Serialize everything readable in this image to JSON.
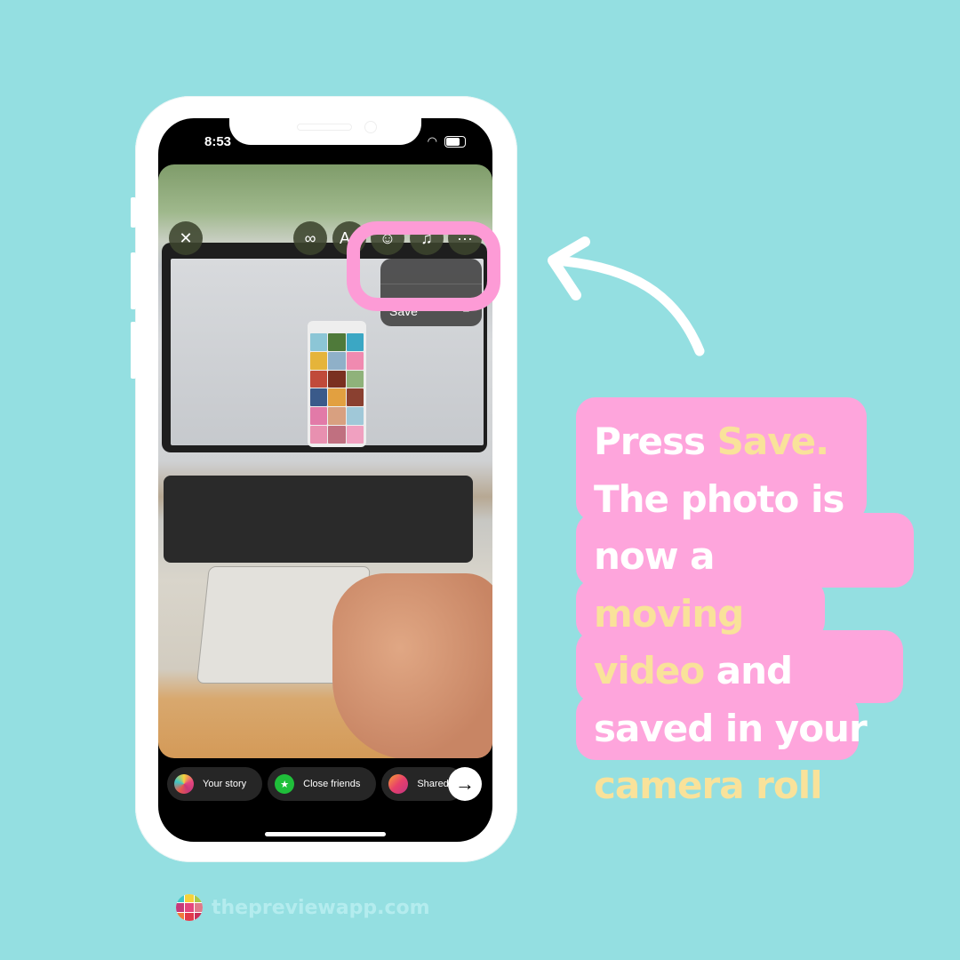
{
  "status_bar": {
    "time": "8:53",
    "wifi_icon": "wifi-icon",
    "battery_icon": "battery-icon"
  },
  "story_editor": {
    "close_icon": "close-icon",
    "toolbar": [
      {
        "name": "boomerang-icon",
        "glyph": "∞"
      },
      {
        "name": "text-icon",
        "glyph": "Aa"
      },
      {
        "name": "sticker-icon",
        "glyph": "☺"
      },
      {
        "name": "music-icon",
        "glyph": "♫"
      },
      {
        "name": "more-icon",
        "glyph": "···"
      }
    ],
    "menu": {
      "save_label": "Save",
      "save_icon": "download-icon"
    }
  },
  "share_bar": {
    "items": [
      {
        "label": "Your story",
        "icon": "preview-app-icon"
      },
      {
        "label": "Close friends",
        "icon": "star-icon",
        "color": "#1fbf3a"
      },
      {
        "label": "Shared",
        "icon": "group-icon",
        "color": "#e8406a"
      }
    ],
    "next_icon": "arrow-right-icon"
  },
  "callout": {
    "lines": [
      [
        {
          "t": "Press ",
          "hl": false
        },
        {
          "t": "Save.",
          "hl": true
        }
      ],
      [
        {
          "t": "The photo is",
          "hl": false
        }
      ],
      [
        {
          "t": "now a ",
          "hl": false
        },
        {
          "t": "moving",
          "hl": true
        }
      ],
      [
        {
          "t": "video",
          "hl": true
        },
        {
          "t": " and",
          "hl": false
        }
      ],
      [
        {
          "t": "saved in your",
          "hl": false
        }
      ],
      [
        {
          "t": "camera roll",
          "hl": true
        }
      ]
    ]
  },
  "footer": {
    "url": "thepreviewapp.com"
  },
  "colors": {
    "background": "#94dfe1",
    "pink": "#fea5dc",
    "highlight_text": "#f9e29a"
  }
}
